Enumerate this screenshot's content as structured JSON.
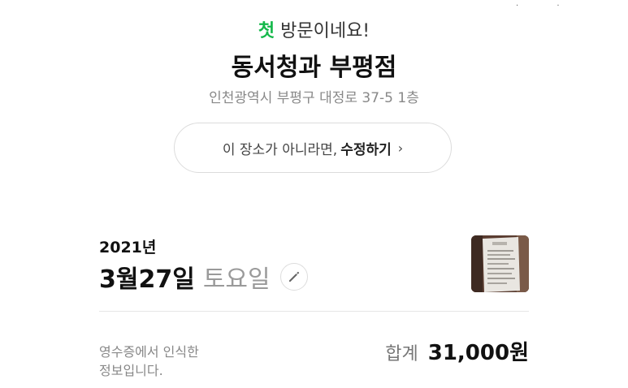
{
  "header": {
    "first_word": "첫",
    "visit_rest": " 방문이네요!",
    "place_name": "동서청과 부평점",
    "address": "인천광역시 부평구 대정로 37-5 1층"
  },
  "edit_place": {
    "prefix": "이 장소가 아니라면,",
    "action": "수정하기",
    "chevron": "›"
  },
  "visit": {
    "year": "2021년",
    "date": "3월27일",
    "weekday": "토요일",
    "edit_icon": "pencil-icon",
    "receipt_icon": "receipt-thumbnail"
  },
  "summary": {
    "recognized_line1": "영수증에서 인식한",
    "recognized_line2": "정보입니다.",
    "total_label": "합계",
    "total_amount": "31,000원"
  },
  "colors": {
    "accent_green": "#14b84a"
  }
}
